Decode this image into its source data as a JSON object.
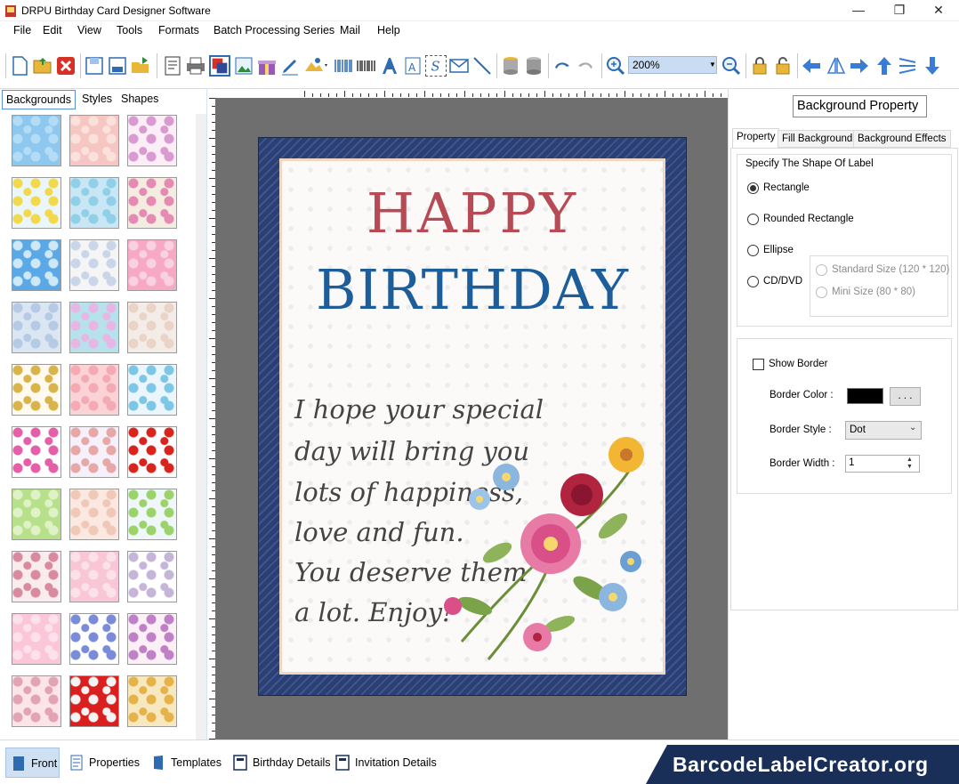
{
  "window": {
    "title": "DRPU Birthday Card Designer Software",
    "minimize": "—",
    "maximize": "❐",
    "close": "✕"
  },
  "menu": [
    "File",
    "Edit",
    "View",
    "Tools",
    "Formats",
    "Batch Processing Series",
    "Mail",
    "Help"
  ],
  "toolbar": {
    "zoom_value": "200%",
    "icons": [
      "new-icon",
      "open-icon",
      "close-icon",
      "save-icon",
      "save-as-icon",
      "export-icon",
      "properties-icon",
      "print-icon",
      "print-preview-icon",
      "background-icon",
      "image-icon",
      "gift-icon",
      "pen-icon",
      "picture-icon",
      "barcode-icon",
      "watermark-icon",
      "text-icon",
      "word-art-icon",
      "symbol-icon",
      "mail-icon",
      "line-icon",
      "database-icon",
      "database-settings-icon",
      "undo-icon",
      "redo-icon",
      "zoom-in-icon",
      "zoom-out-icon",
      "lock-icon",
      "unlock-icon",
      "arrow-left-icon",
      "flip-icon",
      "arrow-right-icon",
      "arrow-up-icon",
      "align-icon",
      "arrow-down-icon"
    ]
  },
  "left_panel": {
    "tabs": [
      "Backgrounds",
      "Styles",
      "Shapes"
    ],
    "active_tab": "Backgrounds"
  },
  "card": {
    "line1": "HAPPY",
    "line2": "BIRTHDAY",
    "message": [
      "I hope your special",
      "day will bring you",
      "lots of happiness,",
      "love and fun.",
      "You deserve them",
      "a lot. Enjoy!"
    ]
  },
  "property_panel": {
    "title": "Background Property",
    "tabs": [
      "Property",
      "Fill Background",
      "Background Effects"
    ],
    "shape_group_label": "Specify The Shape Of Label",
    "shapes": [
      "Rectangle",
      "Rounded Rectangle",
      "Ellipse",
      "CD/DVD"
    ],
    "selected_shape": "Rectangle",
    "cd_options": [
      "Standard Size (120 * 120)",
      "Mini Size (80 * 80)"
    ],
    "show_border_label": "Show Border",
    "show_border_checked": false,
    "border_color_label": "Border Color :",
    "border_color": "#000000",
    "border_color_button": ". . .",
    "border_style_label": "Border Style :",
    "border_style_value": "Dot",
    "border_width_label": "Border Width :",
    "border_width_value": "1"
  },
  "bottom_tabs": [
    "Front",
    "Properties",
    "Templates",
    "Birthday Details",
    "Invitation Details"
  ],
  "active_bottom_tab": "Front",
  "watermark": "BarcodeLabelCreator.org"
}
